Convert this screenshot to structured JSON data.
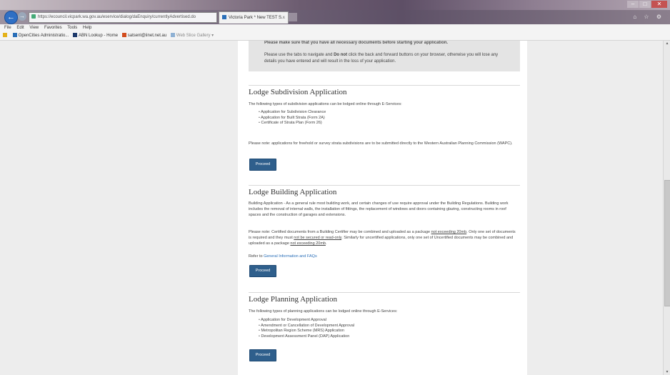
{
  "browser": {
    "address_url": "https://ecouncil.vicpark.wa.gov.au/eservice/dialog/daEnquiry/currentlyAdvertised.do",
    "address_tools": "⌕ ▾ ≡ ✖",
    "tab_title": "Victoria Park * New TEST S...",
    "tab_close": "×",
    "back_glyph": "←",
    "forward_glyph": "→",
    "right_icons": "⌂ ☆ ⚙",
    "window_controls": [
      "–",
      "□",
      "✕"
    ],
    "menu": [
      "File",
      "Edit",
      "View",
      "Favorites",
      "Tools",
      "Help"
    ],
    "favorites": [
      {
        "label": "OpenCities Administratio...",
        "icon": "page-icon"
      },
      {
        "label": "ABN Lookup - Home",
        "icon": "page-icon"
      },
      {
        "label": "satsenl@iinet.net.au",
        "icon": "mail-icon"
      },
      {
        "label": "Web Slice Gallery ▾",
        "icon": "webslice-icon"
      }
    ]
  },
  "notice": {
    "line1": "Please make sure that you have all necessary documents before starting your application.",
    "line2_before": "Please use the tabs to navigate and ",
    "line2_bold": "Do not",
    "line2_after": " click the back and forward buttons on your browser, otherwise you will lose any details you have entered and will result in the loss of your application."
  },
  "subdivision": {
    "title": "Lodge Subdivision Application",
    "intro": "The following types of subdivision applications can be lodged online through E-Services:",
    "items": [
      "Application for Subdivision Clearance",
      "Application for Built Strata (Form 2A)",
      "Certificate of Strata Plan (Form 26)"
    ],
    "note": "Please note: applications for freehold or survey strata subdivisions are to be submitted directly to the Western Australian Planning Commission (WAPC).",
    "button": "Proceed"
  },
  "building": {
    "title": "Lodge Building Application",
    "intro": "Building Application - As a general rule most building work, and certain changes of use require approval under the Building Regulations. Building work includes the removal of internal walls, the installation of fittings, the replacement of windows and doors containing glazing, constructing rooms in roof spaces and the construction of garages and extensions.",
    "note_a": "Please note: Certified documents from a Building Certifier may be combined and uploaded as a package ",
    "note_u1": "not exceeding 20mb",
    "note_b": ". Only one set of documents is required and they must ",
    "note_u2": "not be secured or read-only",
    "note_c": ". Similarly for uncertified applications, only one set of Uncertified documents may be combined and uploaded as a package ",
    "note_u3": "not exceeding 20mb",
    "note_d": ".",
    "refer_prefix": "Refer to ",
    "refer_link": "General Information and FAQs",
    "button": "Proceed"
  },
  "planning": {
    "title": "Lodge Planning Application",
    "intro": "The following types of planning applications can be lodged online through E-Services:",
    "items": [
      "Application for Development Approval",
      "Amendment or Cancellation of Development Approval",
      "Metropolitan Region Scheme (MRS) Application",
      "Development Assessment Panel (DAP) Application"
    ],
    "button": "Proceed"
  },
  "scrollbar": {
    "up": "▴",
    "down": "▾"
  }
}
